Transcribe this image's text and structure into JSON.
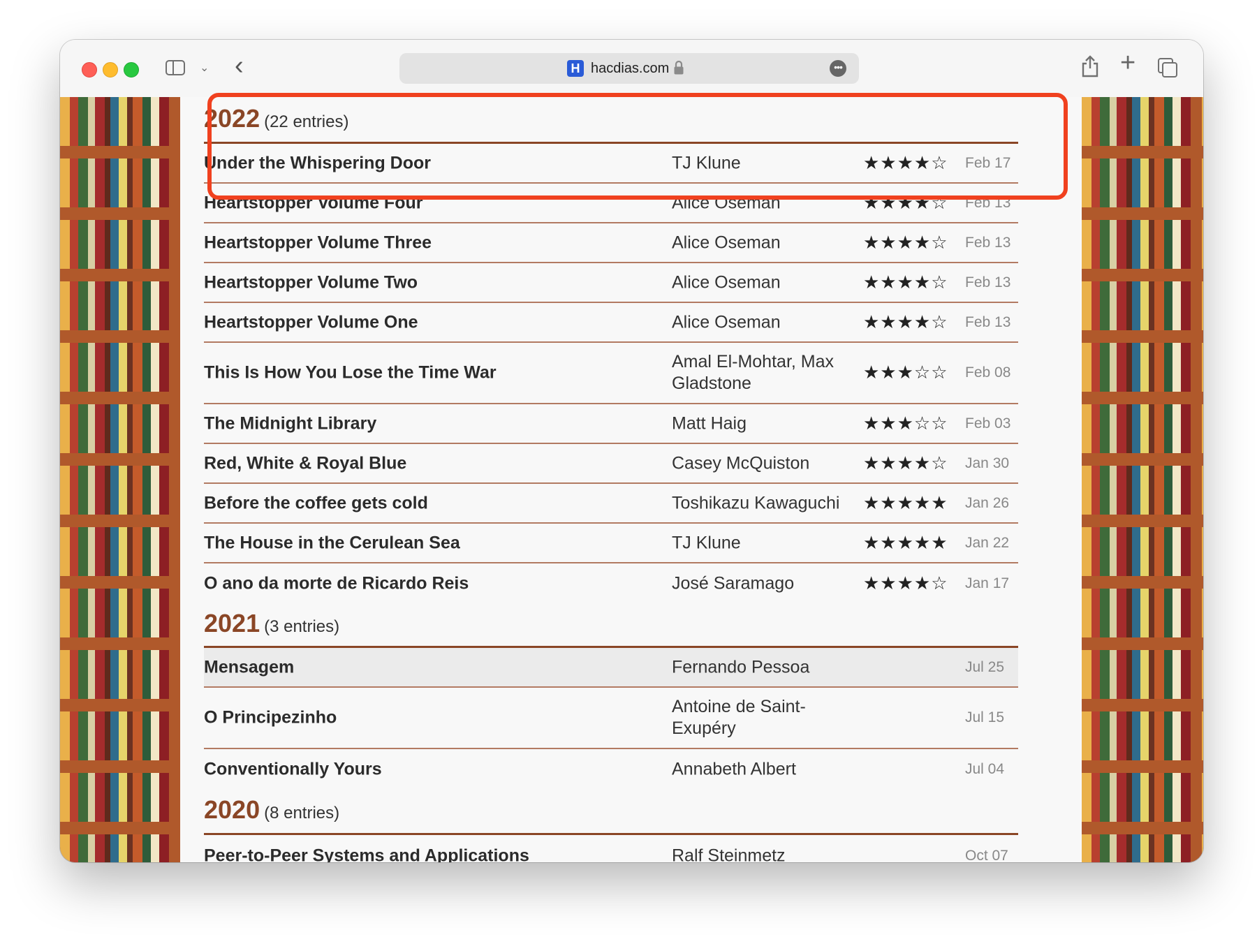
{
  "browser": {
    "url": "hacdias.com",
    "favicon_letter": "H",
    "more_glyph": "•••",
    "back_glyph": "‹",
    "new_tab_glyph": "+",
    "dropdown_glyph": "⌄"
  },
  "colors": {
    "accent": "#8a4626",
    "highlight": "#f0411f"
  },
  "sections": [
    {
      "year": "2022",
      "count": "(22 entries)",
      "rows": [
        {
          "title": "Under the Whispering Door",
          "author": "TJ Klune",
          "stars": "★★★★☆",
          "date": "Feb 17"
        },
        {
          "title": "Heartstopper Volume Four",
          "author": "Alice Oseman",
          "stars": "★★★★☆",
          "date": "Feb 13"
        },
        {
          "title": "Heartstopper Volume Three",
          "author": "Alice Oseman",
          "stars": "★★★★☆",
          "date": "Feb 13"
        },
        {
          "title": "Heartstopper Volume Two",
          "author": "Alice Oseman",
          "stars": "★★★★☆",
          "date": "Feb 13"
        },
        {
          "title": "Heartstopper Volume One",
          "author": "Alice Oseman",
          "stars": "★★★★☆",
          "date": "Feb 13"
        },
        {
          "title": "This Is How You Lose the Time War",
          "author": "Amal El-Mohtar, Max Gladstone",
          "stars": "★★★☆☆",
          "date": "Feb 08"
        },
        {
          "title": "The Midnight Library",
          "author": "Matt Haig",
          "stars": "★★★☆☆",
          "date": "Feb 03"
        },
        {
          "title": "Red, White & Royal Blue",
          "author": "Casey McQuiston",
          "stars": "★★★★☆",
          "date": "Jan 30"
        },
        {
          "title": "Before the coffee gets cold",
          "author": "Toshikazu Kawaguchi",
          "stars": "★★★★★",
          "date": "Jan 26"
        },
        {
          "title": "The House in the Cerulean Sea",
          "author": "TJ Klune",
          "stars": "★★★★★",
          "date": "Jan 22"
        },
        {
          "title": "O ano da morte de Ricardo Reis",
          "author": "José Saramago",
          "stars": "★★★★☆",
          "date": "Jan 17"
        }
      ]
    },
    {
      "year": "2021",
      "count": "(3 entries)",
      "rows": [
        {
          "title": "Mensagem",
          "author": "Fernando Pessoa",
          "stars": "",
          "date": "Jul 25"
        },
        {
          "title": "O Principezinho",
          "author": "Antoine de Saint-Exupéry",
          "stars": "",
          "date": "Jul 15"
        },
        {
          "title": "Conventionally Yours",
          "author": "Annabeth Albert",
          "stars": "",
          "date": "Jul 04"
        }
      ]
    },
    {
      "year": "2020",
      "count": "(8 entries)",
      "rows": [
        {
          "title": "Peer-to-Peer Systems and Applications",
          "author": "Ralf Steinmetz",
          "stars": "",
          "date": "Oct 07"
        }
      ]
    }
  ]
}
